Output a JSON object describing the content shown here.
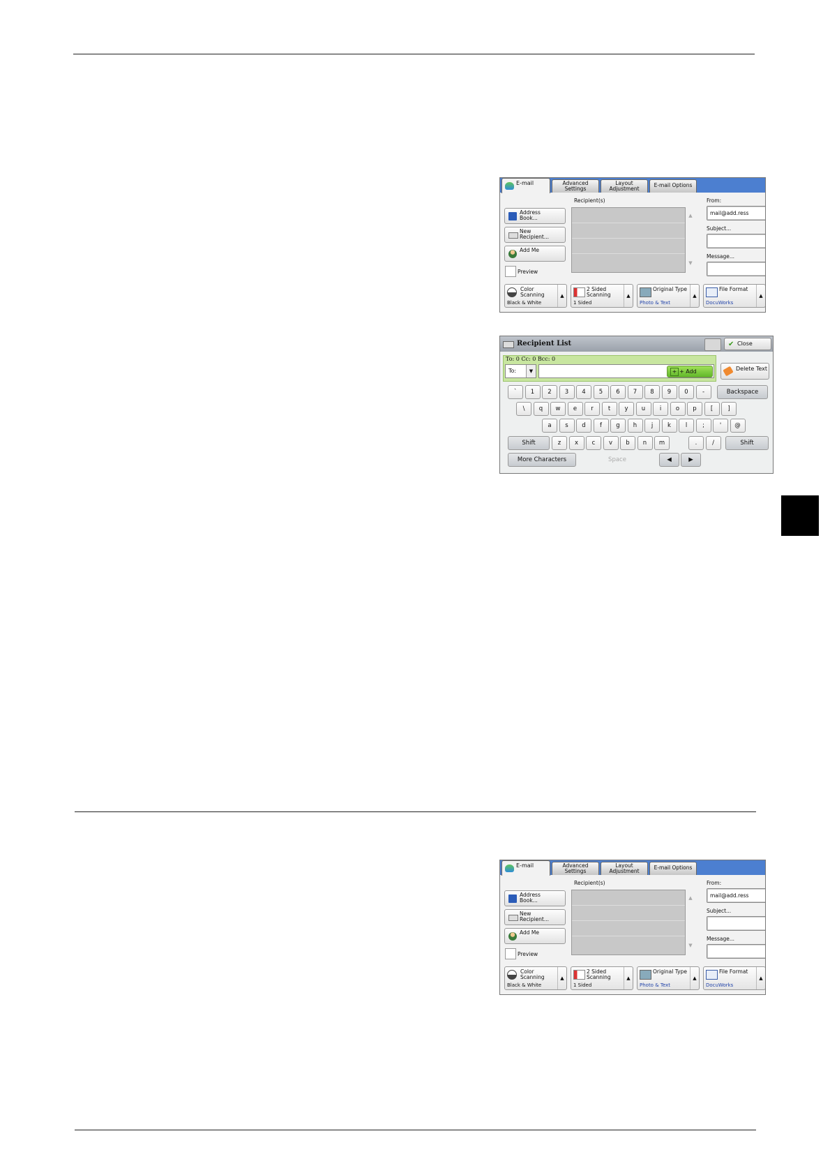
{
  "email_screen": {
    "tabs": [
      "E-mail",
      "Advanced\nSettings",
      "Layout\nAdjustment",
      "E-mail Options"
    ],
    "address_book": "Address\nBook...",
    "new_recipient": "New\nRecipient...",
    "add_me": "Add Me",
    "preview": "Preview",
    "recipients_label": "Recipient(s)",
    "from_label": "From:",
    "from_value": "mail@add.ress",
    "subject_label": "Subject...",
    "message_label": "Message...",
    "color_scanning": {
      "title": "Color\nScanning",
      "value": "Black & White"
    },
    "two_sided": {
      "title": "2 Sided\nScanning",
      "value": "1 Sided"
    },
    "original_type": {
      "title": "Original Type",
      "value": "Photo & Text"
    },
    "file_format": {
      "title": "File Format",
      "value": "DocuWorks"
    }
  },
  "recipient_list": {
    "title": "Recipient List",
    "close": "Close",
    "counts": "To: 0  Cc: 0  Bcc: 0",
    "to_select": "To:",
    "add": "+ Add",
    "delete_text": "Delete Text",
    "row1": [
      "`",
      "1",
      "2",
      "3",
      "4",
      "5",
      "6",
      "7",
      "8",
      "9",
      "0",
      "-"
    ],
    "backspace": "Backspace",
    "row2": [
      "\\",
      "q",
      "w",
      "e",
      "r",
      "t",
      "y",
      "u",
      "i",
      "o",
      "p",
      "[",
      "]"
    ],
    "row3": [
      "a",
      "s",
      "d",
      "f",
      "g",
      "h",
      "j",
      "k",
      "l",
      ";",
      "'",
      "@"
    ],
    "shift": "Shift",
    "row4": [
      "z",
      "x",
      "c",
      "v",
      "b",
      "n",
      "m",
      ".",
      "/"
    ],
    "more_characters": "More Characters",
    "space": "Space"
  }
}
